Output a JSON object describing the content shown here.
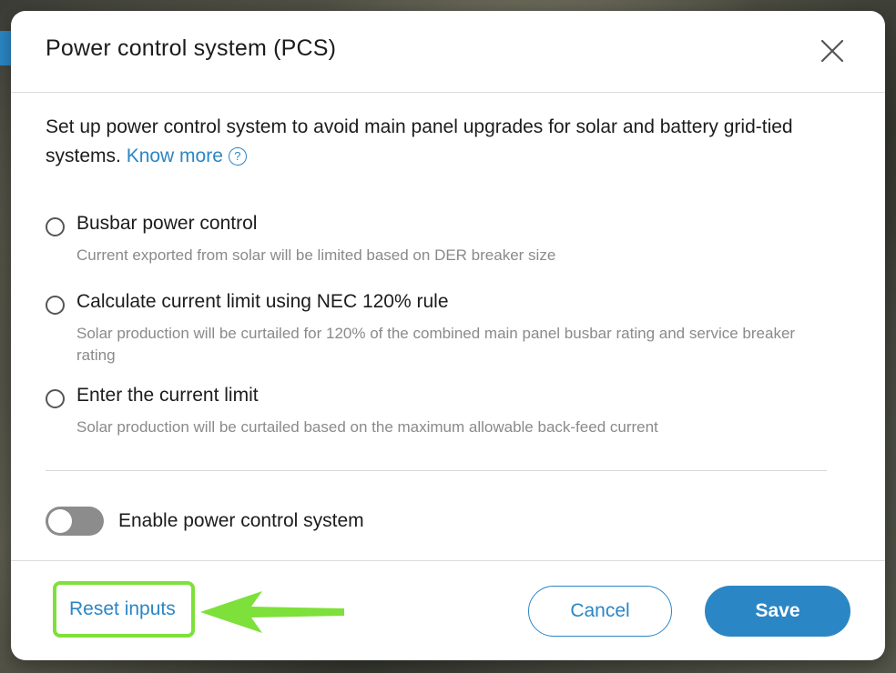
{
  "modal": {
    "title": "Power control system (PCS)",
    "description": "Set up power control system to avoid main panel upgrades for solar and battery grid-tied systems. ",
    "know_more_label": "Know more",
    "help_glyph": "?"
  },
  "options": [
    {
      "label": "Busbar power control",
      "description": "Current exported from solar will be limited based on DER breaker size",
      "selected": false
    },
    {
      "label": "Calculate current limit using NEC 120% rule",
      "description": "Solar production will be curtailed for 120% of the combined main panel busbar rating and service breaker rating",
      "selected": false
    },
    {
      "label": "Enter the current limit",
      "description": "Solar production will be curtailed based on the maximum allowable back-feed current",
      "selected": false
    }
  ],
  "toggle": {
    "label": "Enable power control system",
    "enabled": false
  },
  "footer": {
    "reset_label": "Reset inputs",
    "cancel_label": "Cancel",
    "save_label": "Save"
  },
  "colors": {
    "accent": "#2b86c5",
    "highlight": "#7ee03a",
    "toggle_off": "#8c8c8c"
  }
}
